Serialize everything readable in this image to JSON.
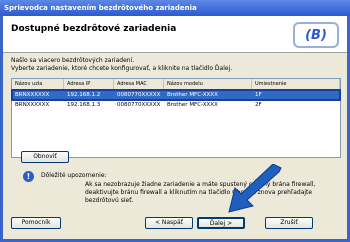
{
  "window": {
    "title": "Sprievodca nastavením bezdrôtového zariadenia"
  },
  "header": {
    "title": "Dostupné bezdrôtové zariadenia",
    "logo": "brother-logo-icon"
  },
  "instructions": {
    "line1": "Našlo sa viacero bezdrôtových zariadení.",
    "line2": "Vyberte zariadenie, ktoré chcete konfigurovať, a kliknite na tlačidlo Ďalej."
  },
  "device_list": {
    "columns": [
      "Názov uzla",
      "Adresa IP",
      "Adresa MAC",
      "Názov modelu",
      "Umiestnenie"
    ],
    "rows": [
      {
        "node": "BRNXXXXXX",
        "ip": "192.168.1.2",
        "mac": "0080770XXXXX",
        "model": "Brother MFC-XXXX",
        "loc": "1F",
        "selected": true
      },
      {
        "node": "BRNXXXXXX",
        "ip": "192.168.1.3",
        "mac": "0080770XXXXX",
        "model": "Brother MFC-XXXX",
        "loc": "2F",
        "selected": false
      }
    ]
  },
  "refresh_label": "Obnoviť",
  "note": {
    "title": "Dôležité upozornenie:",
    "text": "Ak sa nezobrazuje žiadne zariadenie a máte spustený osobný brána firewall, deaktivujte bránu firewall a kliknutím na tlačidlo Obnoviť znova prehľadajte bezdrôtovú sieť."
  },
  "buttons": {
    "help": "Pomocník",
    "back": "< Naspäť",
    "next": "Ďalej >",
    "cancel": "Zrušiť"
  },
  "colors": {
    "selection": "#316ac5",
    "titlebar": "#2c5bd0",
    "arrow": "#1f5fbf"
  }
}
